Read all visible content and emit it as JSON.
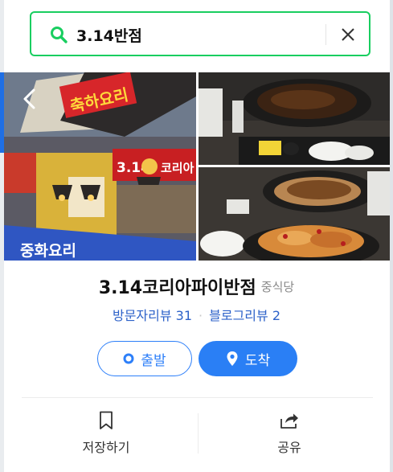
{
  "search": {
    "query": "3.14반점"
  },
  "place": {
    "name": "3.14코리아파이반점",
    "category": "중식당"
  },
  "reviews": {
    "visitor_label": "방문자리뷰",
    "visitor_count": "31",
    "blog_label": "블로그리뷰",
    "blog_count": "2"
  },
  "route": {
    "depart_label": "출발",
    "arrive_label": "도착"
  },
  "actions": {
    "save_label": "저장하기",
    "share_label": "공유"
  },
  "photo_signage": {
    "store_sign": "3.14",
    "store_sign_sub": "코리아",
    "banner": "축하요리",
    "bottom_banner": "중화요리"
  },
  "colors": {
    "search_border": "#19ce60",
    "search_icon": "#19ce60",
    "link_blue": "#2d62c9",
    "primary_blue": "#2a7ff5"
  },
  "icons": {
    "search": "search-icon",
    "clear": "close-icon",
    "prev": "chevron-left-icon",
    "depart": "radio-dot-icon",
    "arrive": "location-pin-icon",
    "save": "bookmark-icon",
    "share": "share-icon"
  }
}
